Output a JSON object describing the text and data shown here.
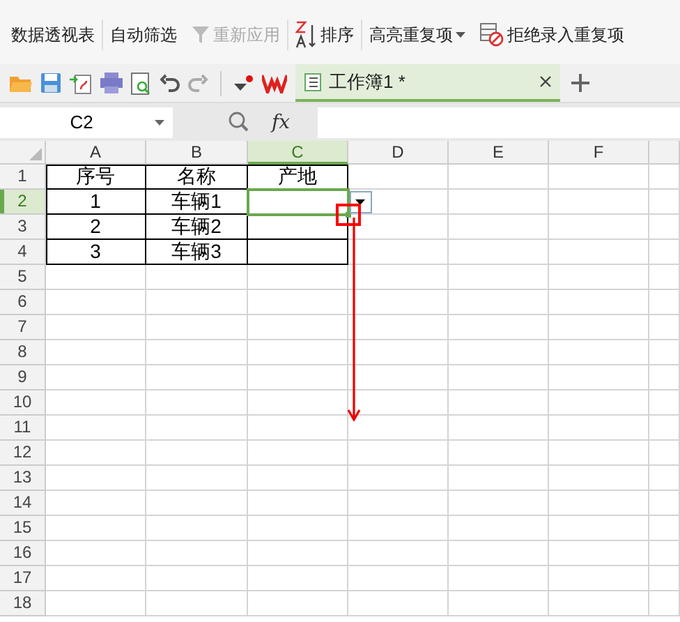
{
  "ribbon": [
    {
      "label": "数据透视表",
      "kind": "plain",
      "disabled": false
    },
    {
      "label": "自动筛选",
      "kind": "plain",
      "disabled": false
    },
    {
      "label": "重新应用",
      "kind": "filter",
      "disabled": true
    },
    {
      "label": "排序",
      "kind": "sort",
      "disabled": false
    },
    {
      "label": "高亮重复项",
      "kind": "dropdown",
      "disabled": false
    },
    {
      "label": "拒绝录入重复项",
      "kind": "forbid",
      "disabled": false
    }
  ],
  "tabs": [
    {
      "label": "工作簿1 *",
      "selected": true
    }
  ],
  "formula_bar": {
    "name_box": "C2",
    "fx": "fx"
  },
  "sheet": {
    "columns": [
      {
        "label": "A",
        "selected": false
      },
      {
        "label": "B",
        "selected": false
      },
      {
        "label": "C",
        "selected": true
      },
      {
        "label": "D",
        "selected": false
      },
      {
        "label": "E",
        "selected": false
      },
      {
        "label": "F",
        "selected": false
      }
    ],
    "rows": [
      {
        "label": "1",
        "selected": false,
        "cells": [
          "序号",
          "名称",
          "产地"
        ]
      },
      {
        "label": "2",
        "selected": true,
        "cells": [
          "1",
          "车辆1"
        ]
      },
      {
        "label": "3",
        "selected": false,
        "cells": [
          "2",
          "车辆2"
        ]
      },
      {
        "label": "4",
        "selected": false,
        "cells": [
          "3",
          "车辆3"
        ]
      },
      {
        "label": "5",
        "selected": false
      },
      {
        "label": "6",
        "selected": false
      },
      {
        "label": "7",
        "selected": false
      },
      {
        "label": "8",
        "selected": false
      },
      {
        "label": "9",
        "selected": false
      },
      {
        "label": "10",
        "selected": false
      },
      {
        "label": "11",
        "selected": false
      },
      {
        "label": "12",
        "selected": false
      },
      {
        "label": "13",
        "selected": false
      },
      {
        "label": "14",
        "selected": false
      },
      {
        "label": "15",
        "selected": false
      },
      {
        "label": "16",
        "selected": false
      },
      {
        "label": "17",
        "selected": false
      },
      {
        "label": "18",
        "selected": false
      }
    ]
  }
}
